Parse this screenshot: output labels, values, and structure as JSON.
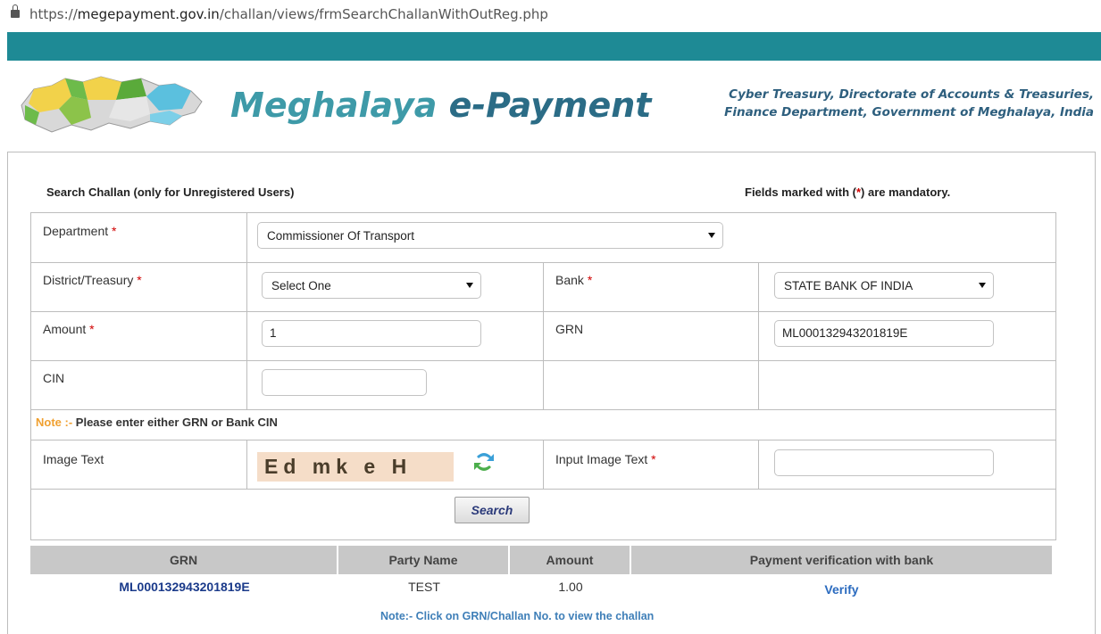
{
  "browser": {
    "url_scheme": "https://",
    "url_host": "megepayment.gov.in",
    "url_path": "/challan/views/frmSearchChallanWithOutReg.php"
  },
  "header": {
    "brand_part1": "Meghalaya",
    "brand_part2": "e-Payment",
    "org_line1": "Cyber Treasury, Directorate of Accounts & Treasuries,",
    "org_line2": "Finance Department, Government of Meghalaya, India"
  },
  "form": {
    "title": "Search Challan (only for Unregistered Users)",
    "mandatory_prefix": "Fields marked with (",
    "mandatory_star": "*",
    "mandatory_suffix": ") are mandatory.",
    "department_label": "Department",
    "department_value": "Commissioner Of Transport",
    "district_label": "District/Treasury",
    "district_value": "Select One",
    "bank_label": "Bank",
    "bank_value": "STATE BANK OF INDIA",
    "amount_label": "Amount",
    "amount_value": "1",
    "grn_label": "GRN",
    "grn_value": "ML000132943201819E",
    "cin_label": "CIN",
    "cin_value": "",
    "note_prefix": "Note :-",
    "note_text": " Please enter either GRN or Bank CIN",
    "image_text_label": "Image Text",
    "captcha_text": "Ed mk e H",
    "input_image_text_label": "Input Image Text",
    "input_image_text_value": "",
    "required_marker": "*",
    "search_button": "Search"
  },
  "results": {
    "columns": [
      "GRN",
      "Party Name",
      "Amount",
      "Payment verification with bank"
    ],
    "rows": [
      {
        "grn": "ML000132943201819E",
        "party_name": "TEST",
        "amount": "1.00",
        "action": "Verify"
      }
    ],
    "note": "Note:- Click on GRN/Challan No. to view the challan"
  },
  "colors": {
    "top_band": "#1e8a95",
    "required": "#d00000"
  }
}
